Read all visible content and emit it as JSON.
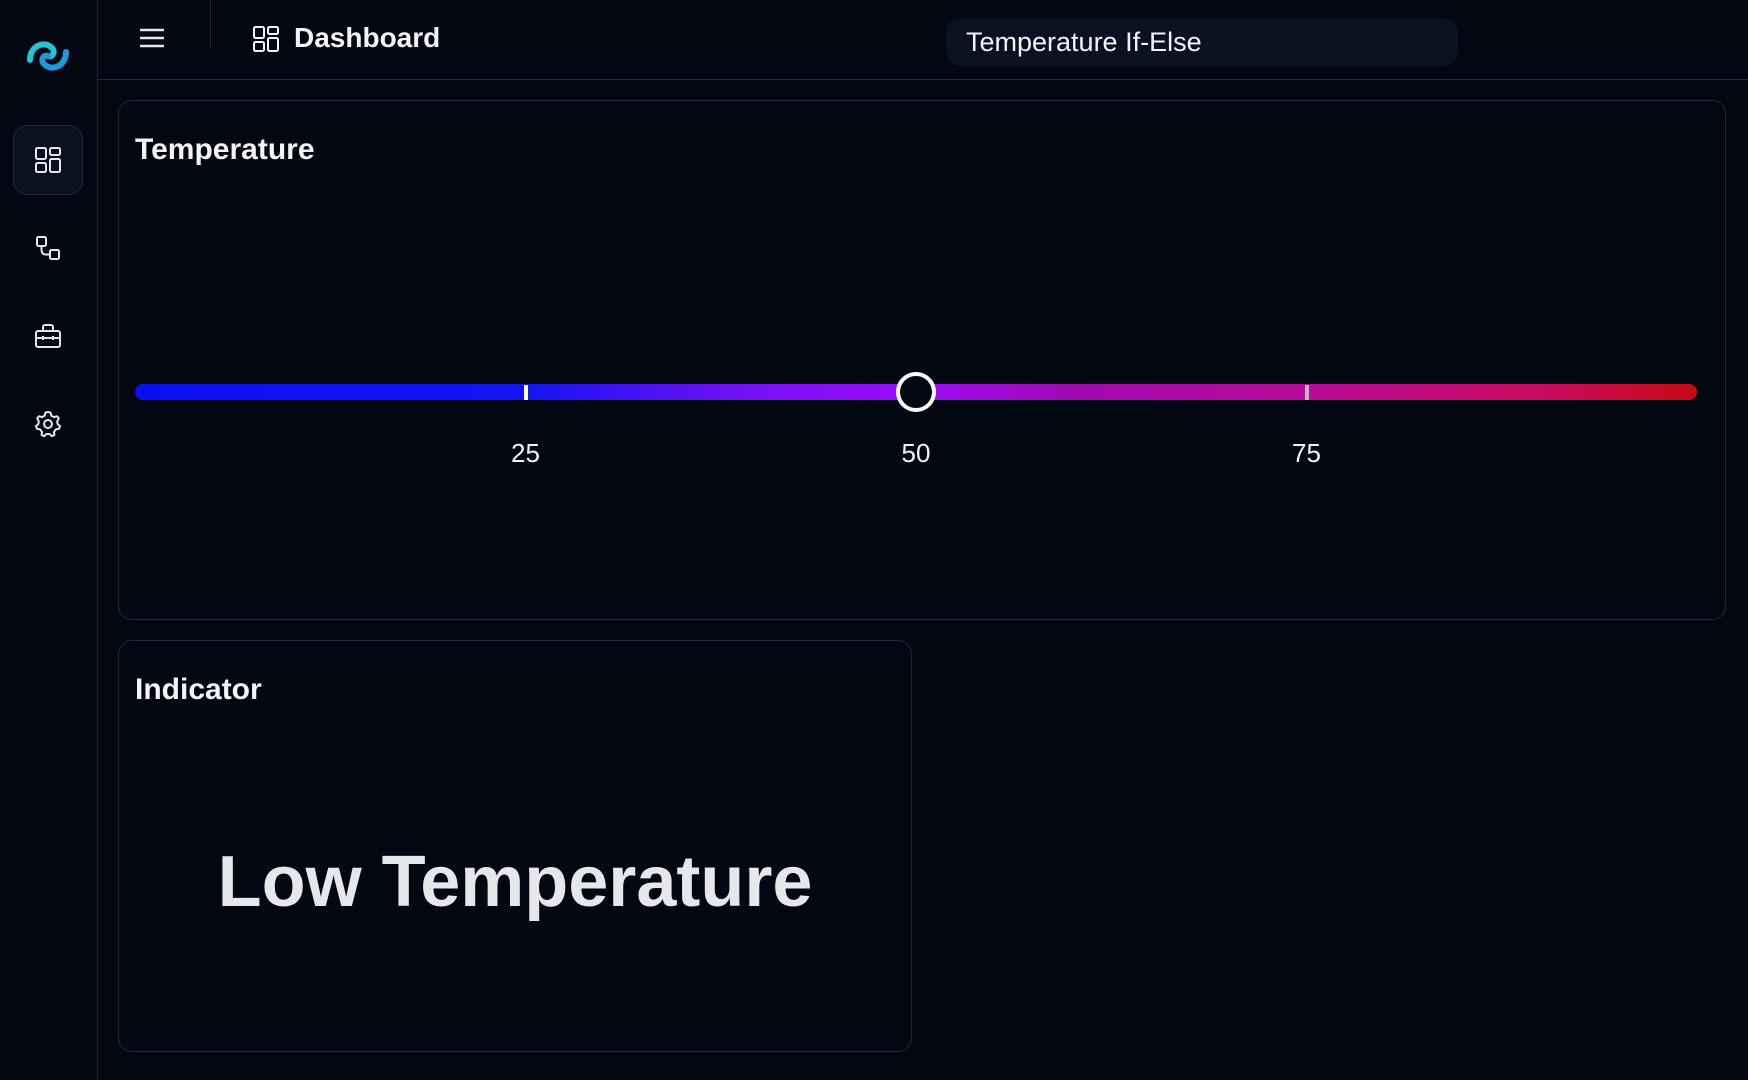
{
  "header": {
    "title": "Dashboard",
    "flow_name": "Temperature If-Else"
  },
  "sidebar": {
    "items": [
      {
        "icon": "dashboard-icon",
        "active": true
      },
      {
        "icon": "flow-icon",
        "active": false
      },
      {
        "icon": "toolbox-icon",
        "active": false
      },
      {
        "icon": "gear-icon",
        "active": false
      }
    ]
  },
  "temperature_card": {
    "title": "Temperature",
    "value": 50,
    "min": 0,
    "max": 100,
    "ticks": [
      {
        "value": 25,
        "label": "25"
      },
      {
        "value": 50,
        "label": "50"
      },
      {
        "value": 75,
        "label": "75"
      }
    ]
  },
  "indicator_card": {
    "title": "Indicator",
    "text": "Low Temperature"
  },
  "colors": {
    "background": "#030712",
    "border": "#1f2937",
    "slider_start": "#0a0ff0",
    "slider_mid": "#9b0cf7",
    "slider_end": "#c80a14",
    "logo_teal": "#22c3d6"
  }
}
